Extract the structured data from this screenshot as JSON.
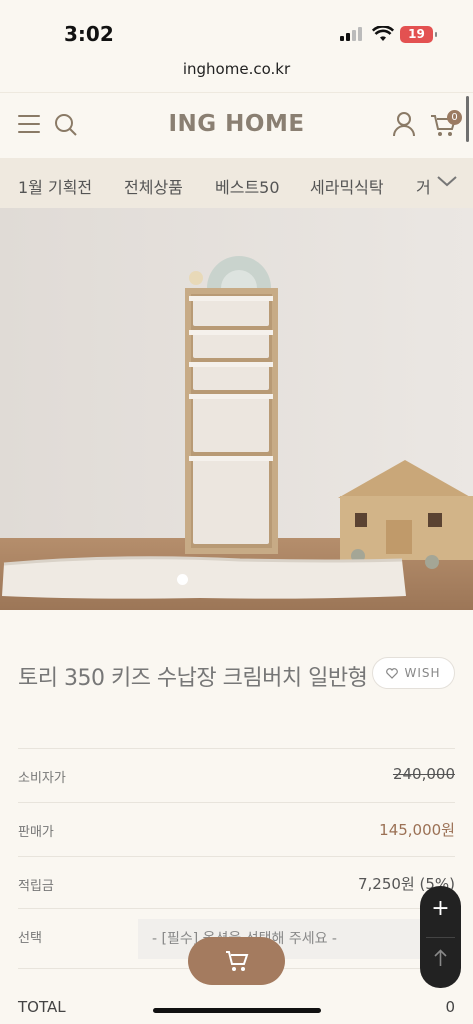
{
  "status": {
    "time": "3:02",
    "battery": "19"
  },
  "browser": {
    "url": "inghome.co.kr"
  },
  "header": {
    "logo": "ING HOME",
    "cart_count": "0"
  },
  "nav": {
    "items": [
      "1월 기획전",
      "전체상품",
      "베스트50",
      "세라믹식탁",
      "거"
    ]
  },
  "product": {
    "title": "토리 350 키즈 수납장 크림버치 일반형",
    "wish_label": "WISH",
    "rows": [
      {
        "label": "소비자가",
        "value": "240,000"
      },
      {
        "label": "판매가",
        "value": "145,000원"
      },
      {
        "label": "적립금",
        "value": "7,250원 (5%)"
      },
      {
        "label": "선택",
        "value": ""
      }
    ],
    "select_placeholder": "- [필수] 옵션을 선택해 주세요 -",
    "total_label": "TOTAL",
    "total_value": "0"
  },
  "icons": [
    "menu-icon",
    "search-icon",
    "user-icon",
    "cart-icon",
    "chevron-down-icon",
    "heart-icon",
    "plus-icon",
    "arrow-up-icon"
  ],
  "colors": {
    "brand": "#a47b5f",
    "price": "#9b7155",
    "nav_bg": "#efe9df",
    "bg": "#faf7f1"
  }
}
